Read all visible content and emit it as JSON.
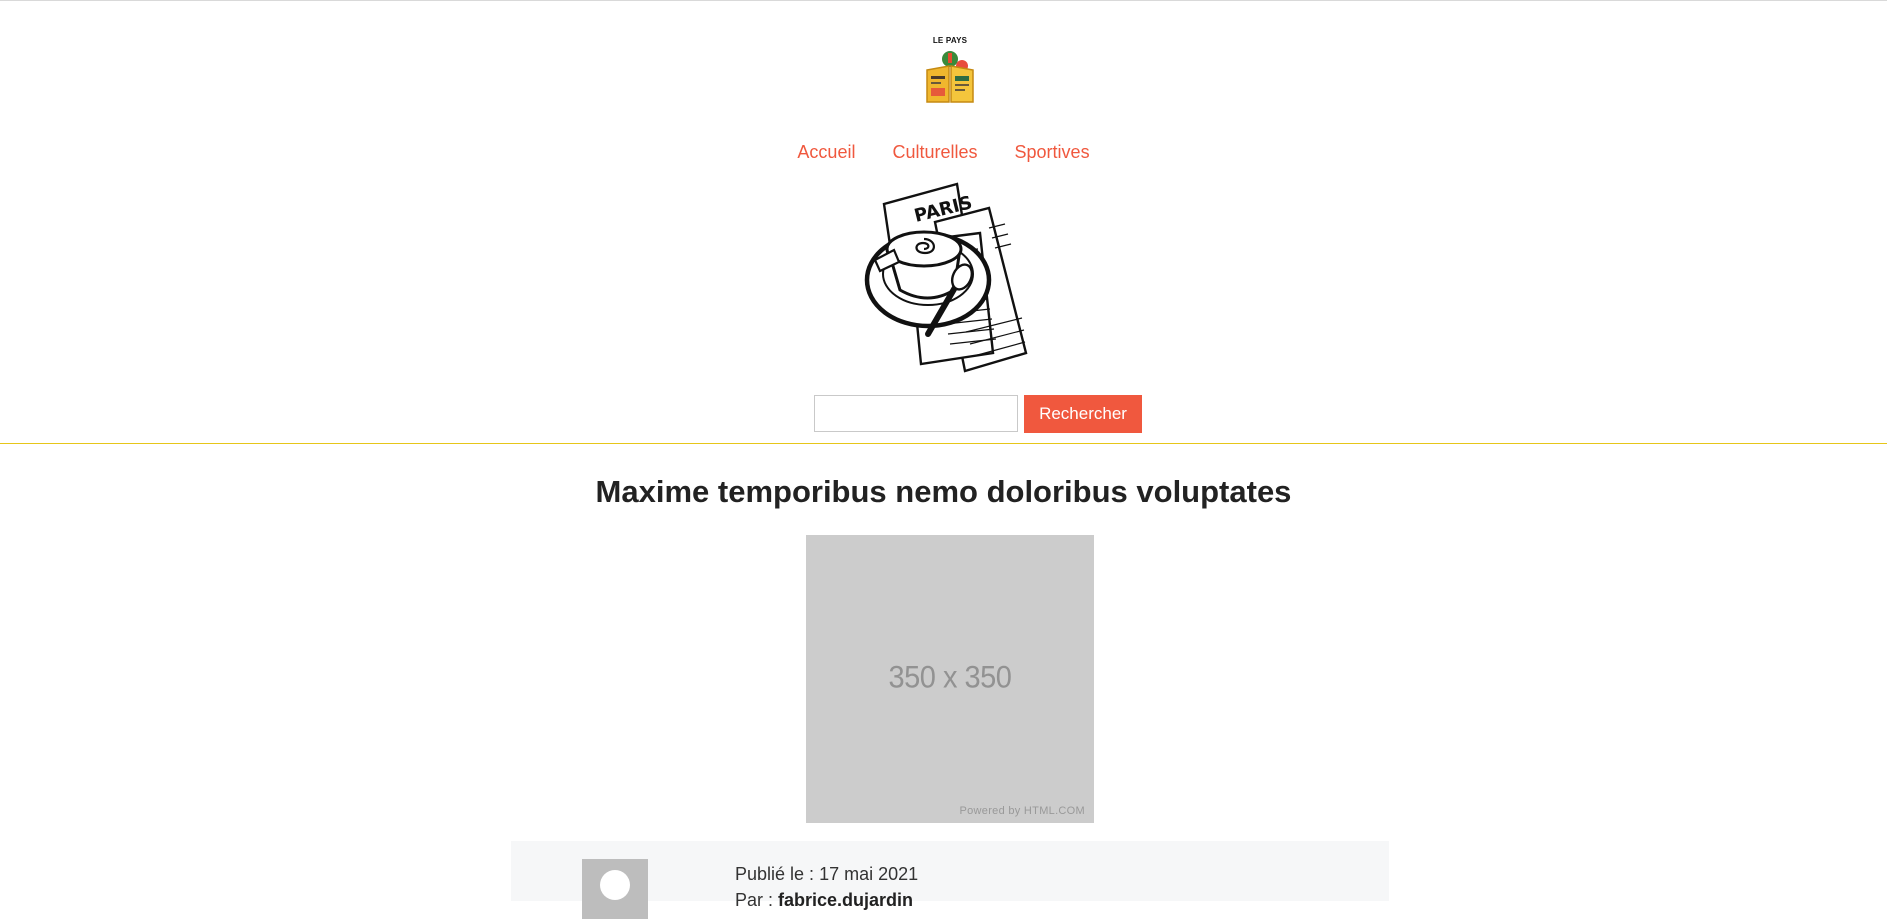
{
  "brand": {
    "logo_text": "LE PAYS"
  },
  "nav": {
    "items": [
      {
        "label": "Accueil"
      },
      {
        "label": "Culturelles"
      },
      {
        "label": "Sportives"
      }
    ]
  },
  "search": {
    "value": "",
    "placeholder": "",
    "button_label": "Rechercher"
  },
  "article": {
    "title": "Maxime temporibus nemo doloribus voluptates",
    "image": {
      "size_label": "350 x 350",
      "powered_by": "Powered by HTML.COM"
    },
    "meta": {
      "published_label": "Publié le : ",
      "published_date": "17 mai 2021",
      "author_label": "Par : ",
      "author_name": "fabrice.dujardin"
    }
  },
  "colors": {
    "accent": "#f0583e",
    "header_divider": "#e6c619",
    "placeholder_bg": "#cccccc",
    "meta_bg": "#f6f7f8"
  },
  "icons": {
    "logo": "newspaper-reader-logo-icon",
    "hero": "coffee-and-newspapers-illustration",
    "avatar": "user-avatar-icon"
  }
}
